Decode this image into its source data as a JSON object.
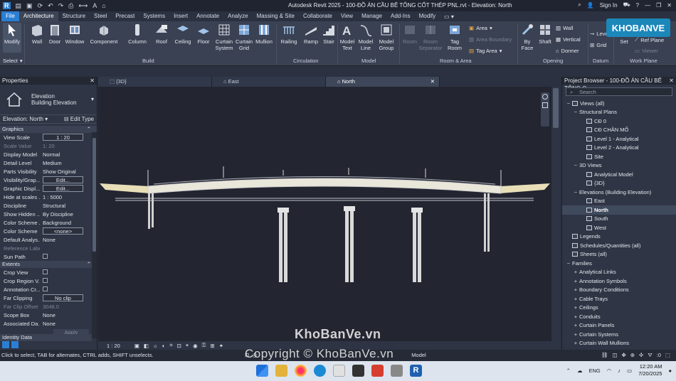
{
  "app": {
    "title": "Autodesk Revit 2025 - 100-ĐỒ ÁN CẦU BÊ TÔNG CỐT THÉP PNL.rvt - Elevation: North",
    "sign_in": "Sign In"
  },
  "ribbon_tabs": [
    "File",
    "Architecture",
    "Structure",
    "Steel",
    "Precast",
    "Systems",
    "Insert",
    "Annotate",
    "Analyze",
    "Massing & Site",
    "Collaborate",
    "View",
    "Manage",
    "Add-Ins",
    "Modify"
  ],
  "ribbon": {
    "modify": "Modify",
    "select": "Select",
    "build": {
      "label": "Build",
      "items": [
        "Wall",
        "Door",
        "Window",
        "Component",
        "Column",
        "Roof",
        "Ceiling",
        "Floor",
        "Curtain System",
        "Curtain Grid",
        "Mullion"
      ]
    },
    "circulation": {
      "label": "Circulation",
      "items": [
        "Railing",
        "Ramp",
        "Stair"
      ]
    },
    "model": {
      "label": "Model",
      "items": [
        "Model Text",
        "Model Line",
        "Model Group"
      ]
    },
    "room_area": {
      "label": "Room & Area",
      "items": [
        "Room",
        "Room Separator",
        "Tag Room",
        "Area",
        "Area Boundary",
        "Tag Area"
      ]
    },
    "opening": {
      "label": "Opening",
      "items": [
        "By Face",
        "Shaft",
        "Wall",
        "Vertical",
        "Dormer"
      ]
    },
    "datum": {
      "label": "Datum",
      "items": [
        "Level",
        "Grid"
      ]
    },
    "work_plane": {
      "label": "Work Plane",
      "items": [
        "Set",
        "Ref Plane",
        "Viewer"
      ]
    }
  },
  "properties": {
    "header": "Properties",
    "type_name": "Elevation",
    "type_sub": "Building Elevation",
    "selector": "Elevation: North",
    "edit_type": "Edit Type",
    "groups": {
      "graphics": "Graphics",
      "extents": "Extents",
      "identity": "Identity Data"
    },
    "rows": [
      {
        "k": "View Scale",
        "v": "1 : 20"
      },
      {
        "k": "Scale Value",
        "v": "1:  20"
      },
      {
        "k": "Display Model",
        "v": "Normal"
      },
      {
        "k": "Detail Level",
        "v": "Medium"
      },
      {
        "k": "Parts Visibility",
        "v": "Show Original"
      },
      {
        "k": "Visibility/Grap...",
        "v": "Edit..."
      },
      {
        "k": "Graphic Displ...",
        "v": "Edit..."
      },
      {
        "k": "Hide at scales ...",
        "v": "1 : 5000"
      },
      {
        "k": "Discipline",
        "v": "Structural"
      },
      {
        "k": "Show Hidden ...",
        "v": "By Discipline"
      },
      {
        "k": "Color Scheme ...",
        "v": "Background"
      },
      {
        "k": "Color Scheme",
        "v": "<none>"
      },
      {
        "k": "Default Analys...",
        "v": "None"
      },
      {
        "k": "Reference Label",
        "v": ""
      },
      {
        "k": "Sun Path",
        "v": ""
      }
    ],
    "extent_rows": [
      {
        "k": "Crop View",
        "v": ""
      },
      {
        "k": "Crop Region V...",
        "v": ""
      },
      {
        "k": "Annotation Cr...",
        "v": ""
      },
      {
        "k": "Far Clipping",
        "v": "No clip"
      },
      {
        "k": "Far Clip Offset",
        "v": "3048.0"
      },
      {
        "k": "Scope Box",
        "v": "None"
      },
      {
        "k": "Associated Da...",
        "v": "None"
      }
    ],
    "apply": "Apply"
  },
  "view_tabs": [
    {
      "label": "{3D}"
    },
    {
      "label": "East"
    },
    {
      "label": "North"
    }
  ],
  "view_bar": {
    "scale": "1 : 20"
  },
  "project_browser": {
    "header": "Project Browser - 100-ĐỒ ÁN CẦU BÊ TÔNG C...",
    "search": "Search",
    "nodes": [
      {
        "label": "Views (all)",
        "lvl": 0,
        "exp": "−",
        "icon": true
      },
      {
        "label": "Structural Plans",
        "lvl": 1,
        "exp": "−"
      },
      {
        "label": "CĐ 0",
        "lvl": 2,
        "icon": true
      },
      {
        "label": "CĐ CHÂN MỐ",
        "lvl": 2,
        "icon": true
      },
      {
        "label": "Level 1 - Analytical",
        "lvl": 2,
        "icon": true
      },
      {
        "label": "Level 2 - Analytical",
        "lvl": 2,
        "icon": true
      },
      {
        "label": "Site",
        "lvl": 2,
        "icon": true
      },
      {
        "label": "3D Views",
        "lvl": 1,
        "exp": "−"
      },
      {
        "label": "Analytical Model",
        "lvl": 2,
        "icon": true
      },
      {
        "label": "{3D}",
        "lvl": 2,
        "icon": true
      },
      {
        "label": "Elevations (Building Elevation)",
        "lvl": 1,
        "exp": "−"
      },
      {
        "label": "East",
        "lvl": 2,
        "icon": true
      },
      {
        "label": "North",
        "lvl": 2,
        "icon": true,
        "sel": true
      },
      {
        "label": "South",
        "lvl": 2,
        "icon": true
      },
      {
        "label": "West",
        "lvl": 2,
        "icon": true
      },
      {
        "label": "Legends",
        "lvl": 0,
        "icon": true
      },
      {
        "label": "Schedules/Quantities (all)",
        "lvl": 0,
        "icon": true
      },
      {
        "label": "Sheets (all)",
        "lvl": 0,
        "icon": true
      },
      {
        "label": "Families",
        "lvl": 0,
        "exp": "−"
      },
      {
        "label": "Analytical Links",
        "lvl": 1,
        "exp": "+"
      },
      {
        "label": "Annotation Symbols",
        "lvl": 1,
        "exp": "+"
      },
      {
        "label": "Boundary Conditions",
        "lvl": 1,
        "exp": "+"
      },
      {
        "label": "Cable Trays",
        "lvl": 1,
        "exp": "+"
      },
      {
        "label": "Ceilings",
        "lvl": 1,
        "exp": "+"
      },
      {
        "label": "Conduits",
        "lvl": 1,
        "exp": "+"
      },
      {
        "label": "Curtain Panels",
        "lvl": 1,
        "exp": "+"
      },
      {
        "label": "Curtain Systems",
        "lvl": 1,
        "exp": "+"
      },
      {
        "label": "Curtain Wall Mullions",
        "lvl": 1,
        "exp": "+"
      }
    ]
  },
  "status": {
    "hint": "Click to select, TAB for alternates, CTRL adds, SHIFT unselects.",
    "model": "Model",
    "zero": ":0"
  },
  "watermarks": {
    "logo": "KHOBANVE",
    "site": "KhoBanVe.vn",
    "copyright": "Copyright © KhoBanVe.vn"
  },
  "taskbar": {
    "lang": "ENG",
    "time": "12:20 AM",
    "date": "7/20/2025"
  },
  "colors": {
    "accent": "#2a7fd4",
    "bg": "#2b3140",
    "canvas": "#232531",
    "deck": "#e8e2c8"
  }
}
